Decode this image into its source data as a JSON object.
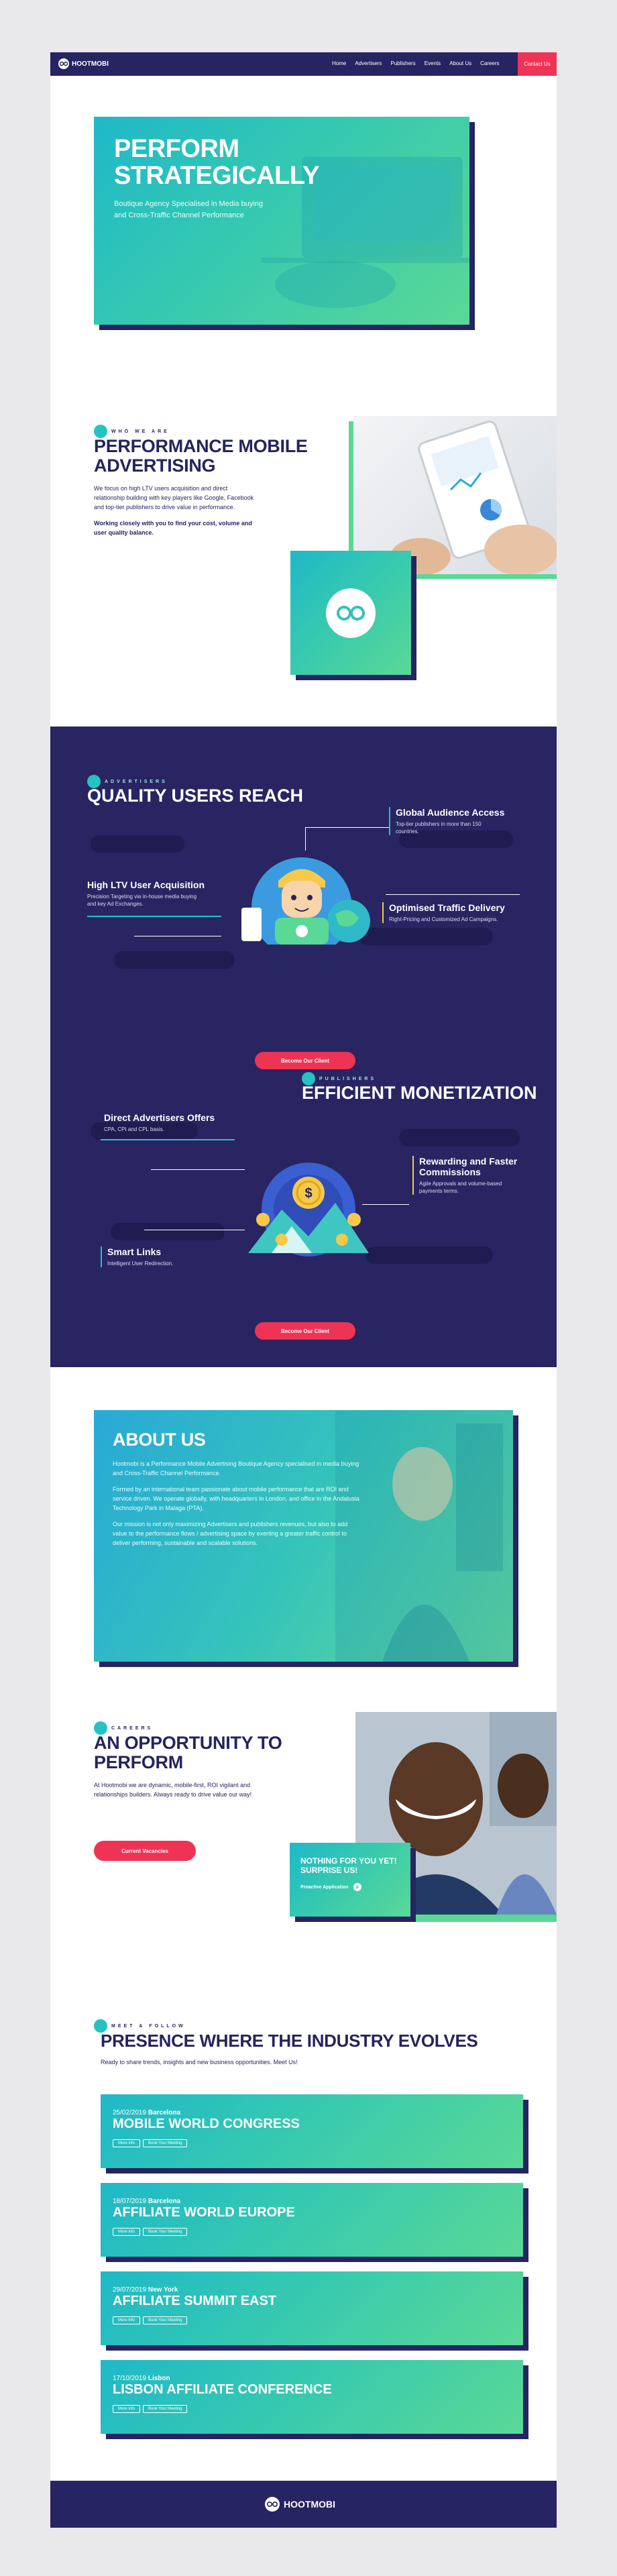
{
  "nav": {
    "brand": "HOOTMOBI",
    "links": [
      "Home",
      "Advertisers",
      "Publishers",
      "Events",
      "About Us",
      "Careers"
    ],
    "contact": "Contact Us"
  },
  "hero": {
    "title_line1": "PERFORM",
    "title_line2": "STRATEGICALLY",
    "sub_line1": "Boutique Agency Specialised in Media buying",
    "sub_line2": "and Cross-Traffic Channel Performance"
  },
  "who": {
    "label": "WHO WE ARE",
    "title_line1": "PERFORMANCE MOBILE",
    "title_line2": "ADVERTISING",
    "para1": "We focus on high LTV users acquisition and direct relationship building with key players like Google, Facebook and top-tier publishers to drive value in performance.",
    "para2": "Working closely with you to find your cost, volume and user quality balance."
  },
  "advertisers": {
    "label": "ADVERTISERS",
    "title": "QUALITY USERS REACH",
    "f1_title": "Global Audience Access",
    "f1_text": "Top-tier publishers in more than 150 countries.",
    "f2_title": "High LTV User Acquisition",
    "f2_text": "Precision Targeting via in-house media buying and key Ad Exchanges.",
    "f3_title": "Optimised Traffic Delivery",
    "f3_text": "Right-Pricing and Customized Ad Campaigns.",
    "button": "Become Our Client"
  },
  "publishers": {
    "label": "PUBLISHERS",
    "title": "EFFICIENT MONETIZATION",
    "f1_title": "Direct Advertisers Offers",
    "f1_text": "CPA, CPI and CPL basis.",
    "f2_title": "Rewarding and Faster Commissions",
    "f2_text": "Agile Approvals and volume-based payments terms.",
    "f3_title": "Smart Links",
    "f3_text": "Intelligent User Redirection.",
    "button": "Become Our Client"
  },
  "about": {
    "title": "ABOUT US",
    "p1": "Hootmobi is a Performance Mobile Advertising Boutique Agency specialised in media buying and Cross-Traffic Channel Performance.",
    "p2": "Formed by an international team passionate about mobile performance that are ROI and service driven. We operate globally, with headquarters in London, and office in the Andalusia Technology Park in Malaga (PTA).",
    "p3": "Our mission is not only maximizing Advertisers and publishers revenues, but also to add value to the performance flows / advertising space by exerting a greater traffic control to deliver performing, sustainable and scalable solutions."
  },
  "careers": {
    "label": "CAREERS",
    "title_line1": "AN OPPORTUNITY TO",
    "title_line2": "PERFORM",
    "text": "At Hootmobi we are dynamic, mobile-first, ROI vigilant and relationships builders. Always ready to drive value our way!",
    "button": "Current Vacancies",
    "card_line1": "NOTHING FOR YOU YET!",
    "card_line2": "SURPRISE US!",
    "card_link": "Proactive Application"
  },
  "events": {
    "label": "MEET & FOLLOW",
    "title": "PRESENCE WHERE THE INDUSTRY EVOLVES",
    "sub": "Ready to share trends, insights and new business opportunities. Meet Us!",
    "btn_a": "More info",
    "btn_b": "Book Your Meeting",
    "items": [
      {
        "date": "25/02/2019",
        "city": "Barcelona",
        "name": "MOBILE WORLD CONGRESS"
      },
      {
        "date": "18/07/2019",
        "city": "Barcelona",
        "name": "AFFILIATE WORLD EUROPE"
      },
      {
        "date": "29/07/2019",
        "city": "New York",
        "name": "AFFILIATE SUMMIT EAST"
      },
      {
        "date": "17/10/2019",
        "city": "Lisbon",
        "name": "LISBON AFFILIATE CONFERENCE"
      }
    ]
  },
  "footer": {
    "brand": "HOOTMOBI"
  },
  "colors": {
    "navy": "#262462",
    "teal": "#25c2c4",
    "green": "#5ad896",
    "pink": "#ef3355"
  }
}
